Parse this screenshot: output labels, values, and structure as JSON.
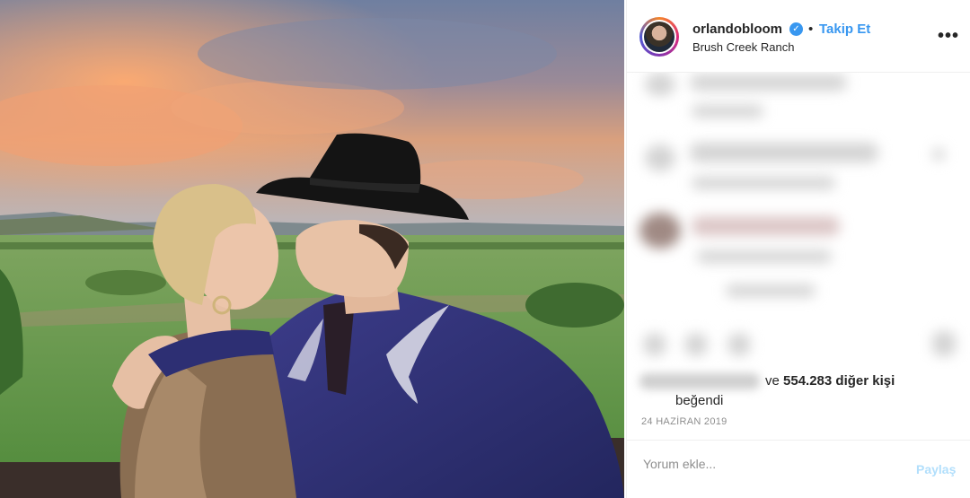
{
  "post": {
    "username": "orlandobloom",
    "verified_icon": "verified-badge-icon",
    "separator": "•",
    "follow_label": "Takip Et",
    "location": "Brush Creek Ranch",
    "more_icon": "more-options-icon",
    "more_glyph": "•••"
  },
  "likes": {
    "prefix": "ve",
    "count_text": "554.283 diğer kişi",
    "suffix": "beğendi"
  },
  "date": "24 HAZİRAN 2019",
  "comment_box": {
    "placeholder": "Yorum ekle...",
    "share_label": "Paylaş"
  },
  "colors": {
    "accent": "#3897f0",
    "share_disabled": "#b2dffc",
    "muted": "#8e8e8e"
  }
}
